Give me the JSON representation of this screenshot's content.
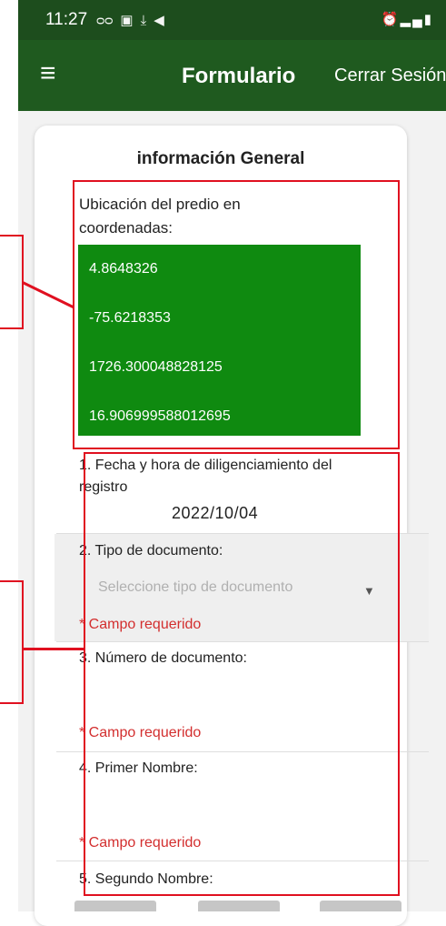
{
  "status_bar": {
    "time": "11:27",
    "icons_left": [
      "voicemail-icon",
      "image-icon",
      "download-icon",
      "navigation-icon"
    ],
    "icons_right": [
      "alarm-icon",
      "signal-icon",
      "battery-icon"
    ]
  },
  "appbar": {
    "title": "Formulario",
    "logout_label": "Cerrar Sesión"
  },
  "card": {
    "heading": "información General",
    "location_label": "Ubicación del predio en coordenadas:",
    "coordinates": [
      "4.8648326",
      "-75.6218353",
      "1726.300048828125",
      "16.906999588012695"
    ]
  },
  "form": {
    "q1_label": "1. Fecha y hora de diligenciamiento del registro",
    "q1_value": "2022/10/04",
    "q2_label": "2. Tipo de documento:",
    "q2_placeholder": "Seleccione tipo de documento",
    "q3_label": "3. Número de documento:",
    "q4_label": "4. Primer Nombre:",
    "q5_label": "5. Segundo Nombre:",
    "required_text": "* Campo requerido"
  },
  "colors": {
    "appbar": "#1f5a1f",
    "statusbar": "#1d4d1d",
    "coords_box": "#0f8a10",
    "required": "#d32f2f",
    "annotation": "#e01020"
  }
}
